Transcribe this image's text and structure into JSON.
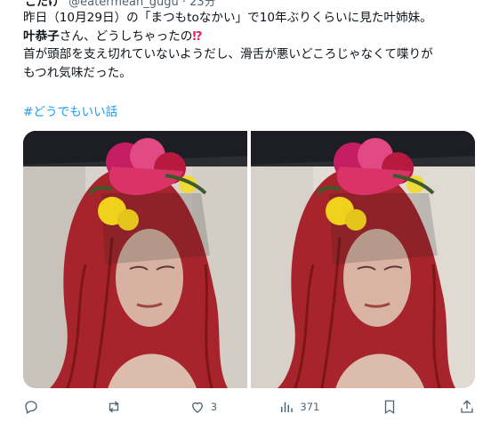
{
  "author": {
    "name": "こたけ",
    "handle": "@eatermean_gugu · 23分"
  },
  "tweet": {
    "line1": "昨日（10月29日）の「まつもtoなかい」で10年ぶりくらいに見た叶姉妹。",
    "line2_name": "叶恭子",
    "line2_rest": "さん、どうしちゃったの",
    "line2_mark": "⁉",
    "line3": "首が頭部を支え切れていないようだし、滑舌が悪いどころじゃなくて喋りが",
    "line4": "もつれ気味だった。",
    "hashtag": "#どうでもいい話"
  },
  "actions": {
    "reply_count": "",
    "retweet_count": "",
    "like_count": "3",
    "views_count": "371"
  },
  "colors": {
    "accent": "#1d9bf0",
    "text": "#0f1419",
    "muted": "#536471",
    "hair": "#b3282e"
  },
  "icons": [
    "reply-icon",
    "retweet-icon",
    "like-icon",
    "views-icon",
    "bookmark-icon",
    "share-icon"
  ]
}
